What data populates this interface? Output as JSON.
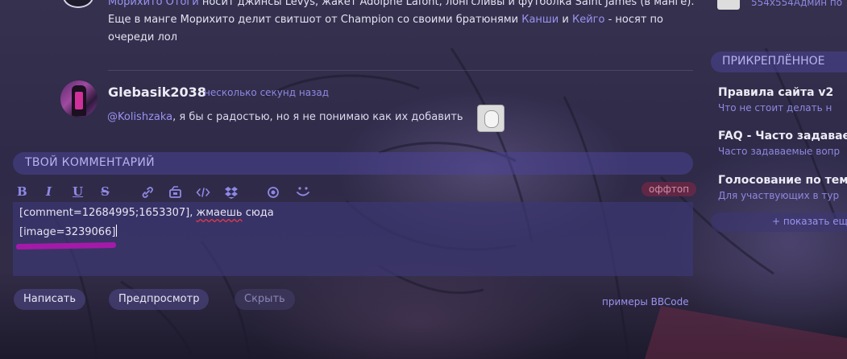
{
  "previous_comment": {
    "segments": [
      {
        "text": "Морихито Отоги",
        "link": true
      },
      {
        "text": " носит джинсы Levys, жакет Adolphe Lafont, лонгсливы и футболка Saint James (в манге). Еще в манге Морихито делит свитшот от Champion со своими братюнями ",
        "link": false
      },
      {
        "text": "Канши",
        "link": true
      },
      {
        "text": " и ",
        "link": false
      },
      {
        "text": "Кейго",
        "link": true
      },
      {
        "text": " - носят по очереди лол",
        "link": false
      }
    ]
  },
  "comment": {
    "author": "Glebasik2038",
    "time": "несколько секунд назад",
    "mention": "@Kolishzaka",
    "text": ", я бы с радостью, но я не понимаю как их добавить"
  },
  "composer": {
    "title": "ТВОЙ КОММЕНТАРИЙ",
    "offtop": "оффтоп",
    "toolbar": {
      "bold": "B",
      "italic": "I",
      "underline": "U",
      "strike": "S",
      "icons": [
        "link-icon",
        "image-icon",
        "code-icon",
        "dropbox-icon",
        "spoiler-icon",
        "smile-icon"
      ]
    },
    "line1_prefix": "[comment=12684995;1653307], ",
    "line1_error": "жмаешь",
    "line1_suffix": " сюда",
    "line2": "[image=3239066]",
    "highlight_color": "#a41aa8"
  },
  "buttons": {
    "submit": "Написать",
    "preview": "Предпросмотр",
    "hide": "Скрыть",
    "bbcode": "примеры BBCode"
  },
  "sidebar": {
    "top_text": "554x554Админ по",
    "pinned_title": "ПРИКРЕПЛЁННОЕ",
    "items": [
      {
        "title": "Правила сайта v2",
        "subtitle": "Что не стоит делать н"
      },
      {
        "title": "FAQ - Часто задавае",
        "subtitle": "Часто задаваемые вопр"
      },
      {
        "title": "Голосование по тем",
        "subtitle": "Для участвующих в тур"
      }
    ],
    "show_more": "+ показать ещ"
  },
  "colors": {
    "accent": "#9b93f0",
    "panel": "#4b4496",
    "offtop_bg": "#6e2846"
  }
}
